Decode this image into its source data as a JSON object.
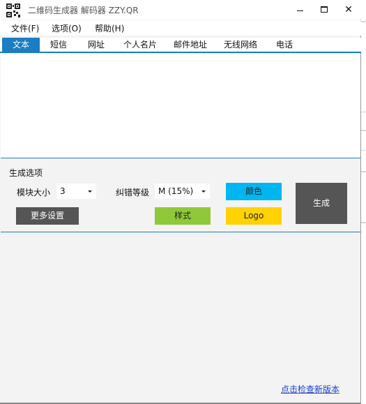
{
  "window": {
    "title": "二维码生成器 解码器 ZZY.QR",
    "minimize": "minimize",
    "maximize": "maximize",
    "close": "✕"
  },
  "menu": [
    {
      "label": "文件(F)"
    },
    {
      "label": "选项(O)"
    },
    {
      "label": "帮助(H)"
    }
  ],
  "tabs": [
    {
      "label": "文本",
      "active": true
    },
    {
      "label": "短信",
      "active": false
    },
    {
      "label": "网址",
      "active": false
    },
    {
      "label": "个人名片",
      "active": false
    },
    {
      "label": "邮件地址",
      "active": false
    },
    {
      "label": "无线网络",
      "active": false
    },
    {
      "label": "电话",
      "active": false
    }
  ],
  "text_input": {
    "value": ""
  },
  "options": {
    "section_title": "生成选项",
    "module_size_label": "模块大小",
    "module_size_value": "3",
    "error_level_label": "纠错等级",
    "error_level_value": "M (15%)",
    "color_button": "颜色",
    "more_settings_button": "更多设置",
    "style_button": "样式",
    "logo_button": "Logo",
    "generate_button": "生成"
  },
  "footer": {
    "update_link": "点击检查新版本"
  },
  "colors": {
    "accent": "#1b7dc3",
    "style_green": "#8fc93a",
    "color_blue": "#00b6f0",
    "logo_yellow": "#ffd200",
    "dark_button": "#555555",
    "link": "#1a3fcf"
  },
  "icons": {
    "app": "qr-code-icon",
    "dropdown": "chevron-down-icon"
  }
}
